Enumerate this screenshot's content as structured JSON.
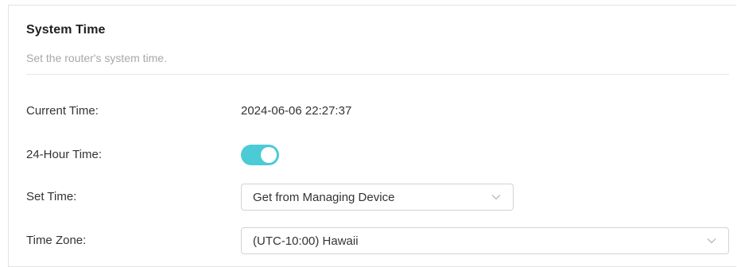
{
  "section": {
    "title": "System Time",
    "subtitle": "Set the router's system time."
  },
  "fields": {
    "current_time": {
      "label": "Current Time:",
      "value": "2024-06-06 22:27:37"
    },
    "hour24": {
      "label": "24-Hour Time:",
      "enabled": true
    },
    "set_time": {
      "label": "Set Time:",
      "selected": "Get from Managing Device"
    },
    "time_zone": {
      "label": "Time Zone:",
      "selected": "(UTC-10:00) Hawaii"
    }
  },
  "colors": {
    "accent": "#4acbd6",
    "text": "#333333",
    "muted": "#a8a8a8",
    "border": "#d3d3d3"
  },
  "icons": {
    "dropdown": "chevron-down-icon"
  }
}
